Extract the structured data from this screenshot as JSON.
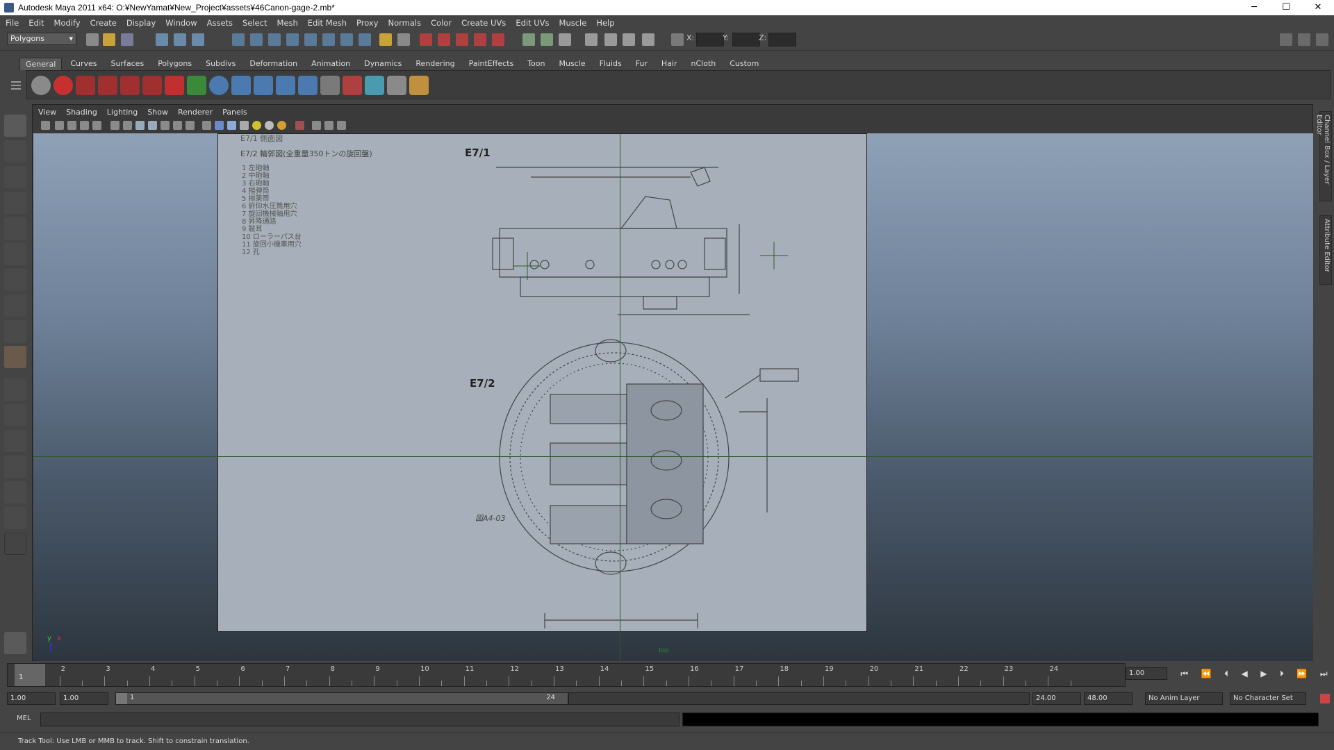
{
  "window": {
    "title": "Autodesk Maya 2011 x64: O:¥NewYamat¥New_Project¥assets¥46Canon-gage-2.mb*",
    "minimize": "─",
    "maximize": "☐",
    "close": "✕"
  },
  "menu": [
    "File",
    "Edit",
    "Modify",
    "Create",
    "Display",
    "Window",
    "Assets",
    "Select",
    "Mesh",
    "Edit Mesh",
    "Proxy",
    "Normals",
    "Color",
    "Create UVs",
    "Edit UVs",
    "Muscle",
    "Help"
  ],
  "status_line": {
    "mode": "Polygons",
    "x_label": "X:",
    "y_label": "Y:",
    "z_label": "Z:"
  },
  "shelf_tabs": [
    "General",
    "Curves",
    "Surfaces",
    "Polygons",
    "Subdivs",
    "Deformation",
    "Animation",
    "Dynamics",
    "Rendering",
    "PaintEffects",
    "Toon",
    "Muscle",
    "Fluids",
    "Fur",
    "Hair",
    "nCloth",
    "Custom"
  ],
  "active_shelf_tab": "General",
  "panel_menu": [
    "View",
    "Shading",
    "Lighting",
    "Show",
    "Renderer",
    "Panels"
  ],
  "image_plane": {
    "note_line1": "E7/1 側面図",
    "note_line2": "E7/2 輪郭図(全重量350トンの旋回盤)",
    "legend": [
      "1 左砲軸",
      "2 中砲軸",
      "3 右砲軸",
      "4 揚弾筒",
      "5 揚薬筒",
      "6 俯仰水圧筒用穴",
      "7 旋回機械軸用穴",
      "8 昇降通路",
      "9 鞍耳",
      "10 ローラーパス台",
      "11 旋回小機車用穴",
      "12 孔"
    ],
    "label_top": "E7/1",
    "label_bottom": "E7/2",
    "handwritten": "図A4-03"
  },
  "viewport": {
    "camera": "top",
    "axis_x": "x",
    "axis_y": "y"
  },
  "right_tabs": [
    "Channel Box / Layer Editor",
    "Attribute Editor"
  ],
  "timeline": {
    "ticks": [
      1,
      2,
      3,
      4,
      5,
      6,
      7,
      8,
      9,
      10,
      11,
      12,
      13,
      14,
      15,
      16,
      17,
      18,
      19,
      20,
      21,
      22,
      23,
      24
    ],
    "current_frame": "1.00",
    "current_tick": "1"
  },
  "range": {
    "start": "1.00",
    "anim_start": "1.00",
    "range_start": "1",
    "range_end": "24",
    "anim_end": "24.00",
    "end": "48.00",
    "anim_layer": "No Anim Layer",
    "character_set": "No Character Set"
  },
  "mel": {
    "label": "MEL"
  },
  "help_line": "Track Tool: Use LMB or MMB to track. Shift to constrain translation.",
  "colors": {
    "bg": "#444444",
    "viewport_top": "#8ea1b7",
    "viewport_bottom": "#2d363f",
    "grid": "#2e5a2e"
  }
}
